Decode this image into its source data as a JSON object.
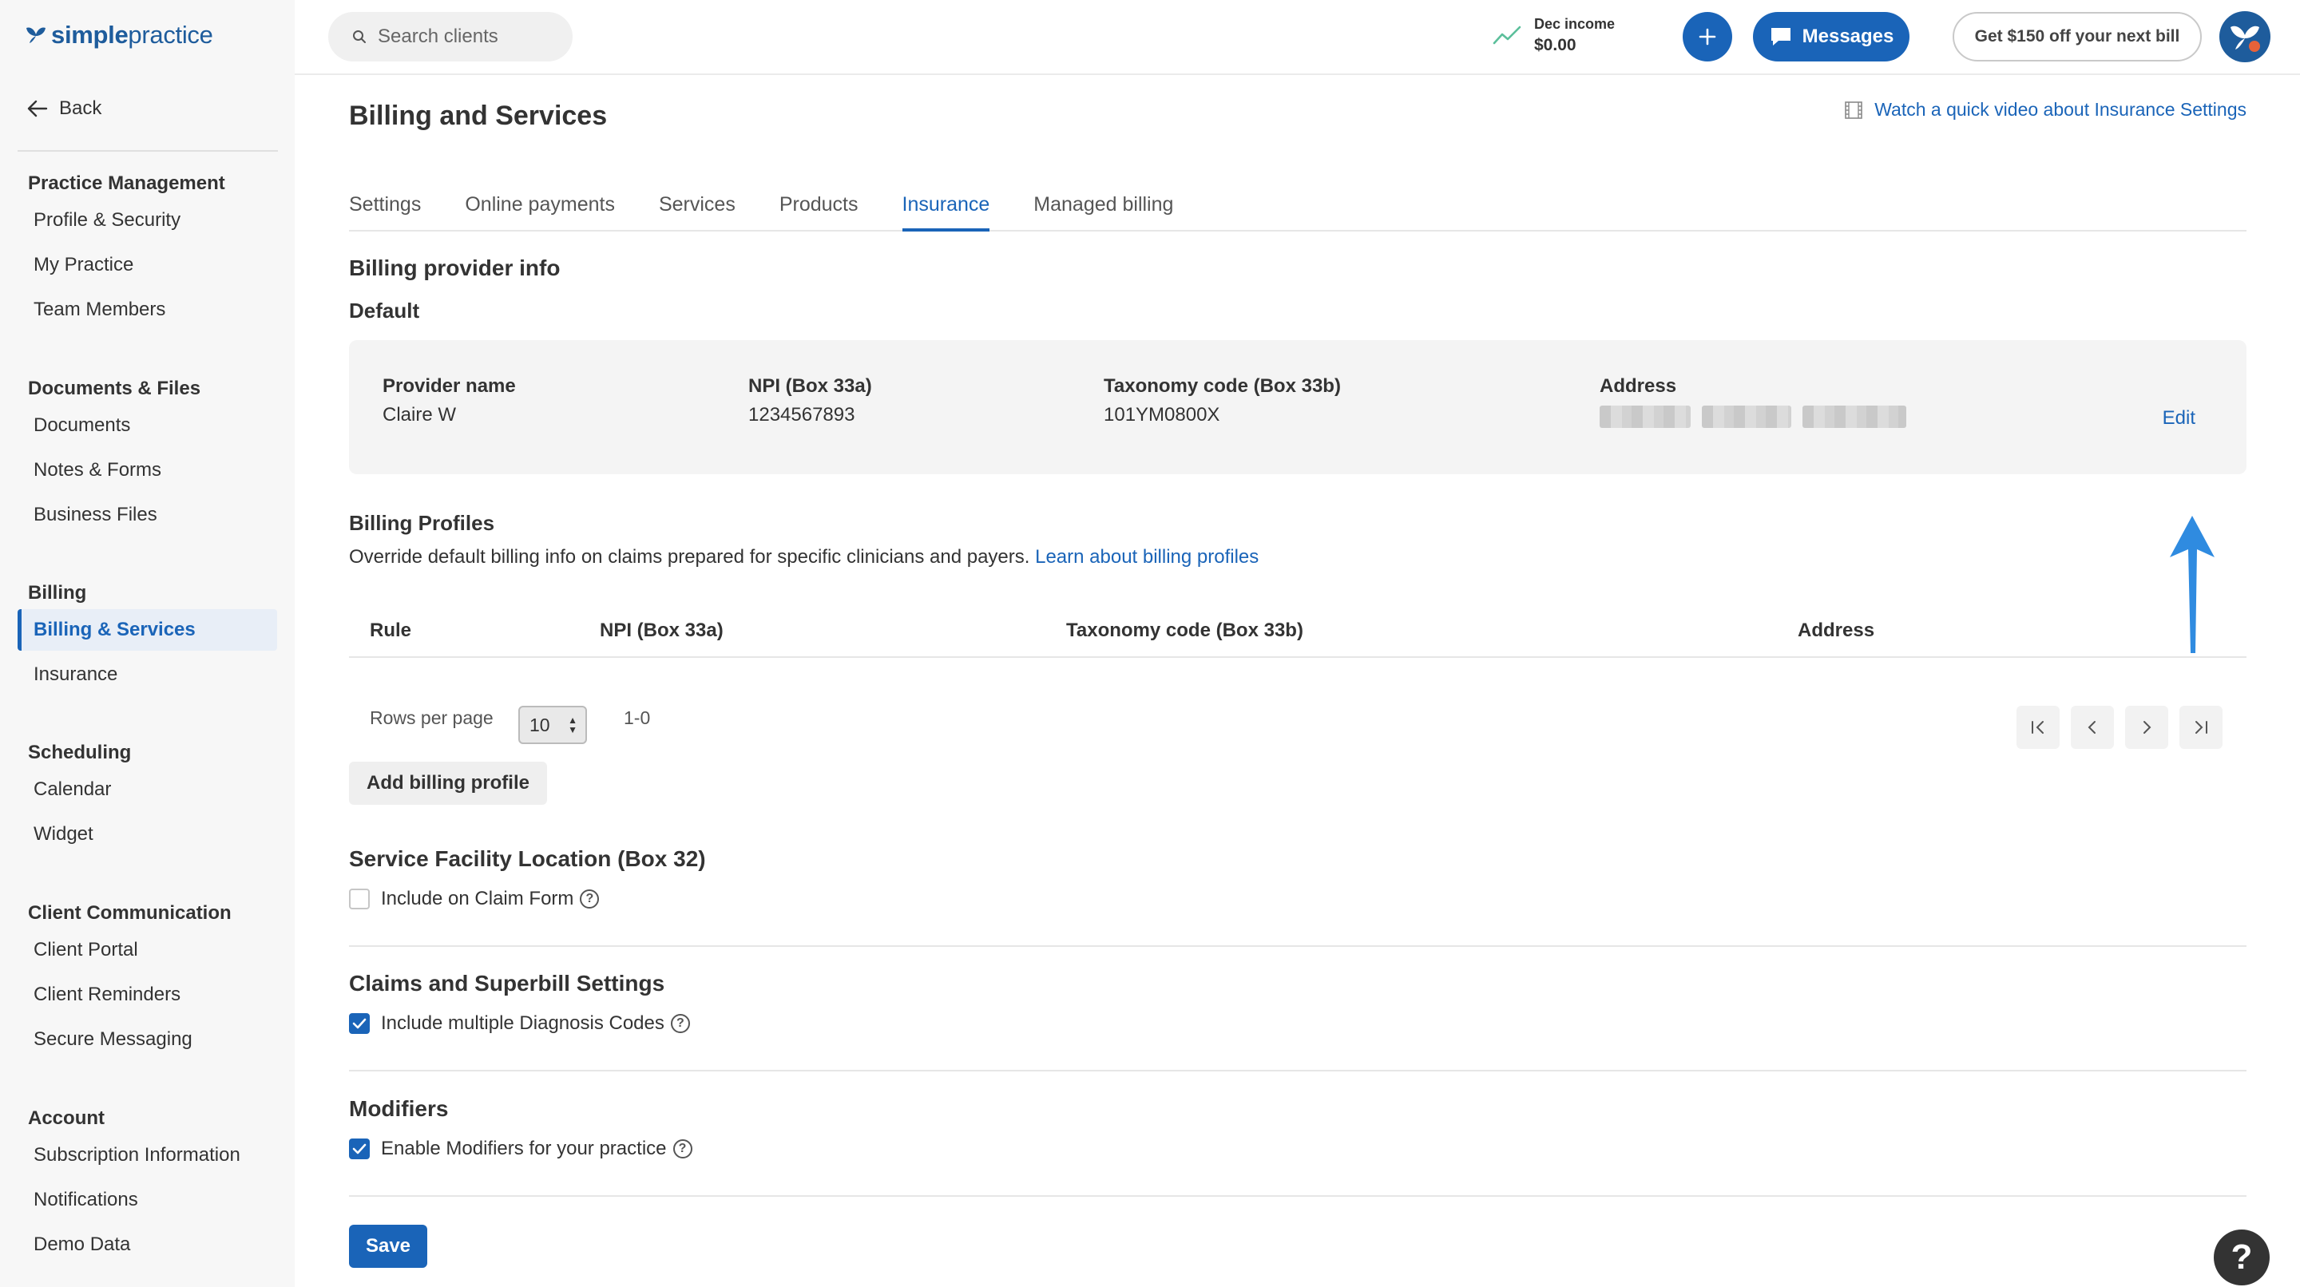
{
  "brand": {
    "part1": "simple",
    "part2": "practice"
  },
  "sidebar": {
    "back_label": "Back",
    "sections": [
      {
        "title": "Practice Management",
        "items": [
          "Profile & Security",
          "My Practice",
          "Team Members"
        ]
      },
      {
        "title": "Documents & Files",
        "items": [
          "Documents",
          "Notes & Forms",
          "Business Files"
        ]
      },
      {
        "title": "Billing",
        "items": [
          "Billing & Services",
          "Insurance"
        ]
      },
      {
        "title": "Scheduling",
        "items": [
          "Calendar",
          "Widget"
        ]
      },
      {
        "title": "Client Communication",
        "items": [
          "Client Portal",
          "Client Reminders",
          "Secure Messaging"
        ]
      },
      {
        "title": "Account",
        "items": [
          "Subscription Information",
          "Notifications",
          "Demo Data"
        ]
      }
    ],
    "active_item": "Billing & Services"
  },
  "header": {
    "search_placeholder": "Search clients",
    "income_label": "Dec income",
    "income_value": "$0.00",
    "plus_label": "+",
    "messages_label": "Messages",
    "promo_label": "Get $150 off your next bill"
  },
  "page": {
    "title": "Billing and Services",
    "video_link": "Watch a quick video about Insurance Settings",
    "tabs": [
      "Settings",
      "Online payments",
      "Services",
      "Products",
      "Insurance",
      "Managed billing"
    ],
    "active_tab": "Insurance"
  },
  "provider": {
    "section_title": "Billing provider info",
    "default_label": "Default",
    "col_name": "Provider name",
    "col_npi": "NPI (Box 33a)",
    "col_taxonomy": "Taxonomy code (Box 33b)",
    "col_address": "Address",
    "name": "Claire W",
    "npi": "1234567893",
    "taxonomy": "101YM0800X",
    "edit_label": "Edit"
  },
  "profiles": {
    "title": "Billing Profiles",
    "description": "Override default billing info on claims prepared for specific clinicians and payers.",
    "learn_link": "Learn about billing profiles",
    "columns": [
      "Rule",
      "NPI (Box 33a)",
      "Taxonomy code (Box 33b)",
      "Address"
    ],
    "rows_per_page_label": "Rows per page",
    "rows_per_page_value": "10",
    "range": "1-0",
    "add_label": "Add billing profile"
  },
  "facility": {
    "title": "Service Facility Location (Box 32)",
    "checkbox_label": "Include on Claim Form",
    "checked": false
  },
  "claims": {
    "title": "Claims and Superbill Settings",
    "checkbox_label": "Include multiple Diagnosis Codes",
    "checked": true
  },
  "modifiers": {
    "title": "Modifiers",
    "checkbox_label": "Enable Modifiers for your practice",
    "checked": true
  },
  "save_label": "Save",
  "help_label": "?",
  "colors": {
    "accent": "#1a64b8",
    "brand": "#1e5c9c",
    "sidebar_bg": "#f7f7f7"
  }
}
